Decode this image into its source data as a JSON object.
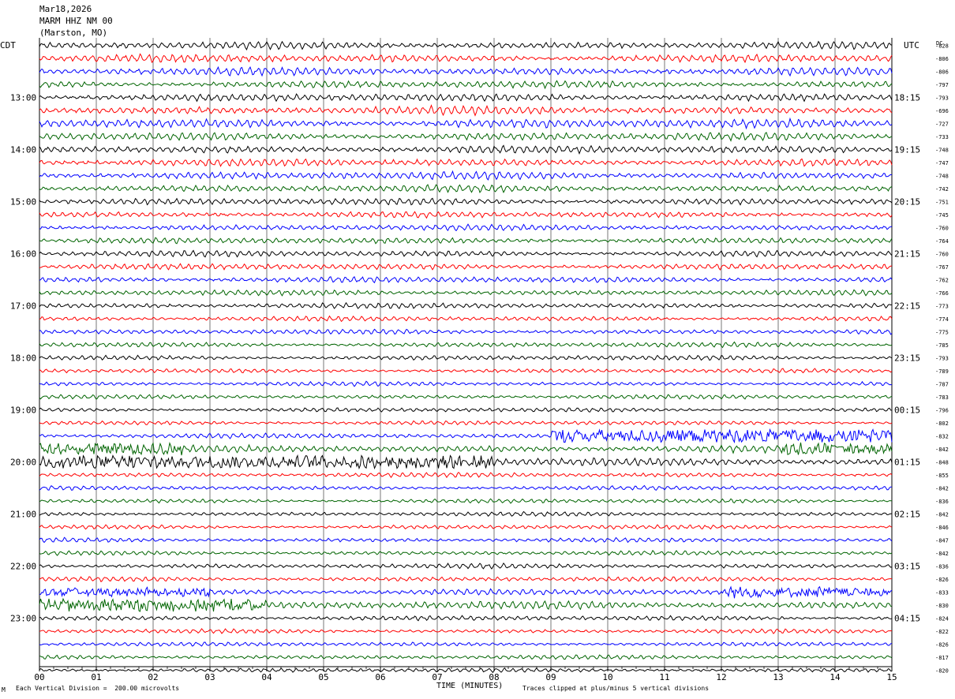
{
  "header": {
    "date": "Mar18,2026",
    "station": "MARM HHZ NM 00",
    "location": "(Marston, MO)"
  },
  "footer": {
    "corner_mark": "M",
    "scale_note": "Each Vertical Division =  200.00 microvolts",
    "xlabel": "TIME (MINUTES)",
    "clip_note": "Traces clipped at plus/minus 5 vertical divisions"
  },
  "chart_data": {
    "type": "line",
    "title": "MARM HHZ NM 00",
    "xlabel": "TIME (MINUTES)",
    "xlim": [
      0,
      15
    ],
    "x_ticks": [
      "00",
      "01",
      "02",
      "03",
      "04",
      "05",
      "06",
      "07",
      "08",
      "09",
      "10",
      "11",
      "12",
      "13",
      "14",
      "15"
    ],
    "left_axis_label": "CDT",
    "right_axis_label": "UTC",
    "dc_label": "DC",
    "left_hour_labels": [
      "13:00",
      "14:00",
      "15:00",
      "16:00",
      "17:00",
      "18:00",
      "19:00",
      "20:00",
      "21:00",
      "22:00",
      "23:00"
    ],
    "right_hour_labels": [
      "18:15",
      "19:15",
      "20:15",
      "21:15",
      "22:15",
      "23:15",
      "00:15",
      "01:15",
      "02:15",
      "03:15",
      "04:15"
    ],
    "trace_colors": [
      "#000000",
      "#ff0000",
      "#0000ff",
      "#006400"
    ],
    "dc_offsets": [
      -828,
      -806,
      -806,
      -797,
      -793,
      -696,
      -727,
      -733,
      -748,
      -747,
      -748,
      -742,
      -751,
      -745,
      -760,
      -764,
      -760,
      -767,
      -762,
      -766,
      -773,
      -774,
      -775,
      -785,
      -793,
      -789,
      -787,
      -783,
      -796,
      -802,
      -832,
      -842,
      -848,
      -855,
      -842,
      -836,
      -842,
      -846,
      -847,
      -842,
      -836,
      -826,
      -833,
      -830,
      -824,
      -822,
      -826,
      -817,
      -820
    ],
    "amplitude_levels": [
      1.2,
      1.3,
      1.3,
      1.2,
      1.3,
      1.4,
      1.5,
      1.3,
      1.3,
      1.2,
      1.3,
      1.2,
      1.1,
      1.0,
      1.0,
      1.0,
      1.0,
      1.0,
      1.0,
      0.9,
      0.9,
      0.8,
      0.8,
      0.8,
      0.8,
      0.7,
      0.7,
      0.7,
      0.7,
      0.7,
      0.8,
      1.2,
      1.5,
      0.8,
      0.7,
      0.7,
      0.7,
      0.7,
      0.7,
      0.7,
      0.8,
      0.8,
      1.0,
      1.3,
      0.8,
      0.7,
      0.7,
      0.7,
      0.7
    ],
    "noise_bursts": [
      {
        "trace": 30,
        "start_min": 9.0,
        "end_min": 15.0,
        "amp": 1.6
      },
      {
        "trace": 31,
        "start_min": 0.0,
        "end_min": 2.5,
        "amp": 1.3
      },
      {
        "trace": 31,
        "start_min": 13.0,
        "end_min": 15.0,
        "amp": 1.2
      },
      {
        "trace": 32,
        "start_min": 0.0,
        "end_min": 8.0,
        "amp": 1.4
      },
      {
        "trace": 42,
        "start_min": 0.0,
        "end_min": 3.0,
        "amp": 0.9
      },
      {
        "trace": 42,
        "start_min": 12.0,
        "end_min": 15.0,
        "amp": 1.2
      },
      {
        "trace": 43,
        "start_min": 0.0,
        "end_min": 4.0,
        "amp": 1.6
      }
    ]
  }
}
